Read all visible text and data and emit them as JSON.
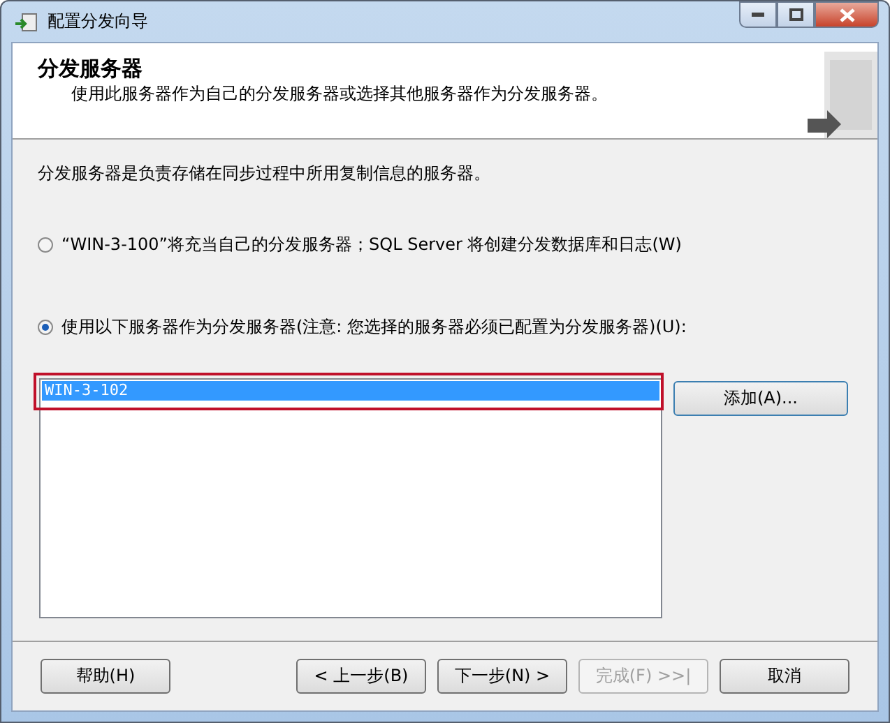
{
  "window": {
    "title": "配置分发向导"
  },
  "header": {
    "title": "分发服务器",
    "subtitle": "使用此服务器作为自己的分发服务器或选择其他服务器作为分发服务器。"
  },
  "description": "分发服务器是负责存储在同步过程中所用复制信息的服务器。",
  "options": [
    {
      "label": "“WIN-3-100”将充当自己的分发服务器；SQL Server 将创建分发数据库和日志(W)",
      "selected": false
    },
    {
      "label": "使用以下服务器作为分发服务器(注意: 您选择的服务器必须已配置为分发服务器)(U):",
      "selected": true
    }
  ],
  "servers": [
    {
      "name": "WIN-3-102",
      "selected": true
    }
  ],
  "add_button": "添加(A)...",
  "buttons": [
    {
      "label": "帮助(H)",
      "disabled": false
    },
    {
      "label": "< 上一步(B)",
      "disabled": false
    },
    {
      "label": "下一步(N) >",
      "disabled": false
    },
    {
      "label": "完成(F) >>|",
      "disabled": true
    },
    {
      "label": "取消",
      "disabled": false
    }
  ]
}
